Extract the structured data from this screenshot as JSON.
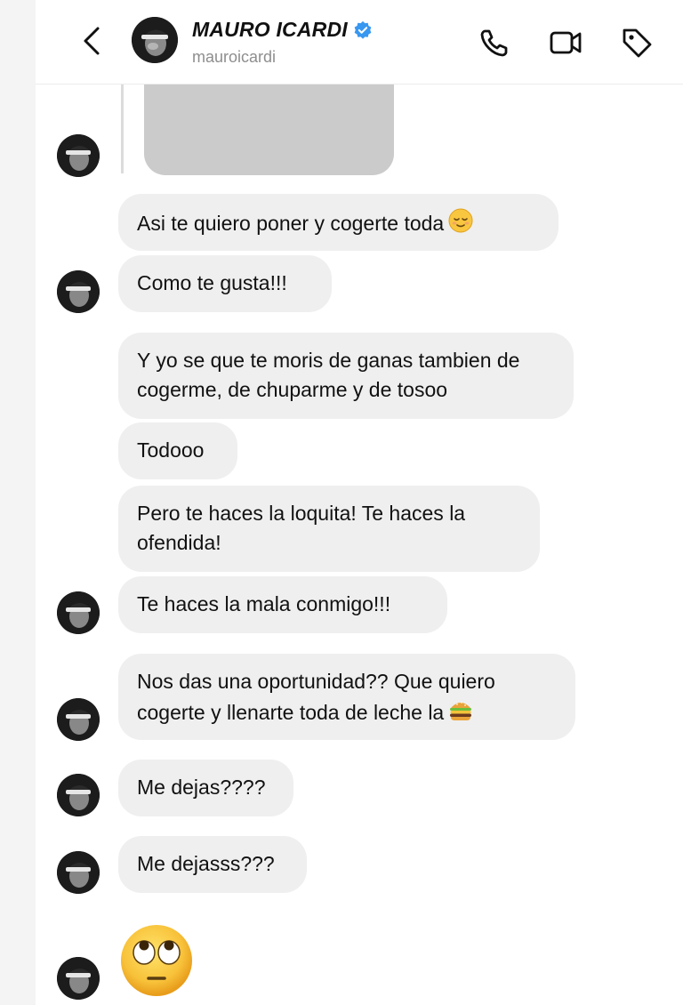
{
  "header": {
    "name": "MAURO ICARDI",
    "handle": "mauroicardi",
    "icons": [
      "back-chevron-icon",
      "verified-badge-icon",
      "phone-icon",
      "video-camera-icon",
      "tag-icon"
    ]
  },
  "colors": {
    "bubble": "#efefef",
    "text": "#111111",
    "verified": "#3897f0",
    "muted": "#8e8e8e"
  },
  "messages": [
    {
      "text": "Asi te quiero poner y cogerte toda",
      "emoji": "relieved-face-icon"
    },
    {
      "text": "Como te gusta!!!"
    },
    {
      "text": "Y yo se que te moris de ganas tambien de cogerme, de chuparme y de tosoo"
    },
    {
      "text": "Todooo"
    },
    {
      "text": "Pero te haces la loquita! Te haces la ofendida!"
    },
    {
      "text": "Te haces la mala conmigo!!!"
    },
    {
      "text": "Nos das una oportunidad?? Que quiero cogerte y llenarte toda de leche la",
      "emoji": "hamburger-icon"
    },
    {
      "text": "Me dejas????"
    },
    {
      "text": "Me dejasss???"
    },
    {
      "emoji": "face-with-rolling-eyes-icon"
    }
  ]
}
